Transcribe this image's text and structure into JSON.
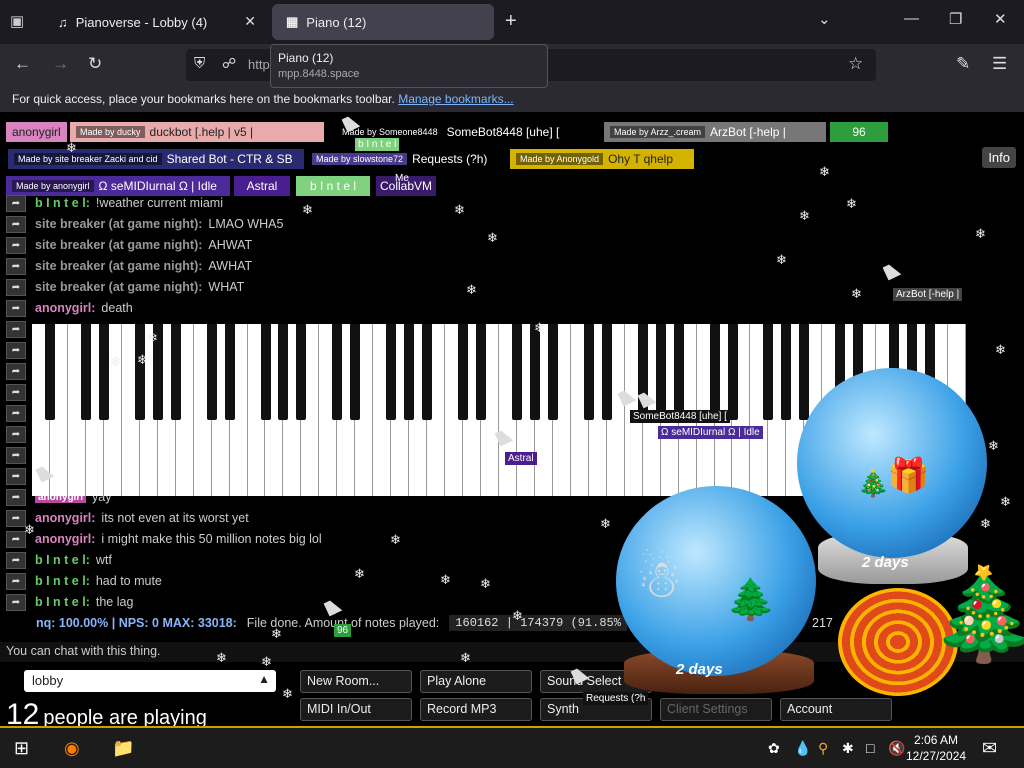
{
  "browser": {
    "tabs": [
      {
        "title": "Pianoverse - Lobby (4)"
      },
      {
        "title": "Piano (12)"
      }
    ],
    "tooltip": {
      "title": "Piano (12)",
      "url": "mpp.8448.space"
    },
    "url_partial": "http",
    "bookmarks_text": "For quick access, place your bookmarks here on the bookmarks toolbar.",
    "bookmarks_link": "Manage bookmarks..."
  },
  "badges": {
    "row1": [
      {
        "name": "anonygirl",
        "color": "#d884c0"
      },
      {
        "maker": "Made by ducky",
        "name": "duckbot [.help | v5 |",
        "color": "#e8aaaa"
      },
      {
        "maker": "Made by Someone8448",
        "name": "SomeBot8448 [uhe] [",
        "color": "#000"
      },
      {
        "maker": "Made by Arzz_.cream",
        "name": "ArzBot [-help | ",
        "color": "#777"
      },
      {
        "name": "96",
        "color": "#2c9f3c"
      }
    ],
    "row2": [
      {
        "maker": "Made by site breaker Zacki and cid",
        "name": "Shared Bot - CTR & SB",
        "color": "#2a2a70"
      },
      {
        "maker": "Made by slowstone72",
        "name": "Requests (?h)",
        "color": "#000"
      },
      {
        "maker": "Made by Anonygold",
        "name": "Ohy T qhelp",
        "color": "#d4b200"
      }
    ],
    "row3": [
      {
        "maker": "Made by anonygirl",
        "name": "Ω seMIDIurnal Ω | Idle",
        "color": "#4b2a99"
      },
      {
        "name": "Astral",
        "color": "#4b1e8f"
      },
      {
        "name": "b I n t e l",
        "color": "#7fd37f"
      },
      {
        "name": "CollabVM",
        "color": "#3a1a6a"
      }
    ],
    "floating": [
      "b I n t e l",
      "Me"
    ],
    "info": "Info"
  },
  "chat": [
    {
      "name": "b I n t e l:",
      "msg": "!weather current miami",
      "color": "#66cc66"
    },
    {
      "name": "site breaker (at game night):",
      "msg": "LMAO WHA5",
      "color": "#999"
    },
    {
      "name": "site breaker (at game night):",
      "msg": "AHWAT",
      "color": "#999"
    },
    {
      "name": "site breaker (at game night):",
      "msg": "AWHAT",
      "color": "#999"
    },
    {
      "name": "site breaker (at game night):",
      "msg": "WHAT",
      "color": "#999"
    },
    {
      "name": "anonygirl:",
      "msg": "death",
      "color": "#d884c0"
    },
    {
      "name": "anonygirl",
      "msg": "yay",
      "color": "#d884c0"
    },
    {
      "name": "anonygirl:",
      "msg": "its not even at its worst yet",
      "color": "#d884c0"
    },
    {
      "name": "anonygirl:",
      "msg": "i might make this 50 million notes big lol",
      "color": "#d884c0"
    },
    {
      "name": "b I n t e l:",
      "msg": "wtf",
      "color": "#66cc66"
    },
    {
      "name": "b I n t e l:",
      "msg": "had to mute",
      "color": "#66cc66"
    },
    {
      "name": "b I n t e l:",
      "msg": "the lag",
      "color": "#66cc66"
    }
  ],
  "status": {
    "text": "nq: 100.00% | NPS: 0 MAX: 33018:",
    "file": "File done. Amount of notes played:",
    "counter": "160162 | 174379 (91.85%",
    "tail": "217"
  },
  "cursors": [
    {
      "label": "SomeBot8448 [uhe] [",
      "color": "#111"
    },
    {
      "label": "Ω seMIDIurnal Ω | Idle",
      "color": "#4b2a99"
    },
    {
      "label": "Astral",
      "color": "#4b1e8f"
    },
    {
      "label": "anonygirl",
      "color": "#b84aa0"
    },
    {
      "label": "ArzBot [-help |",
      "color": "#444"
    },
    {
      "label": "96",
      "color": "#2c9f3c"
    },
    {
      "label": "Requests (?h",
      "color": "#111"
    }
  ],
  "globes": [
    {
      "plaque": "2 days"
    },
    {
      "plaque": "2 days"
    }
  ],
  "chat_input": "You can chat with this thing.",
  "room": {
    "value": "lobby",
    "people_count": "12",
    "people_label": "people are playing"
  },
  "buttons": {
    "new_room": "New Room...",
    "play_alone": "Play Alone",
    "sound_select": "Sound Select",
    "midi_inout": "MIDI In/Out",
    "record_mp3": "Record MP3",
    "synth": "Synth",
    "client_settings": "Client Settings",
    "account": "Account"
  },
  "taskbar": {
    "time": "2:06 AM",
    "date": "12/27/2024"
  }
}
